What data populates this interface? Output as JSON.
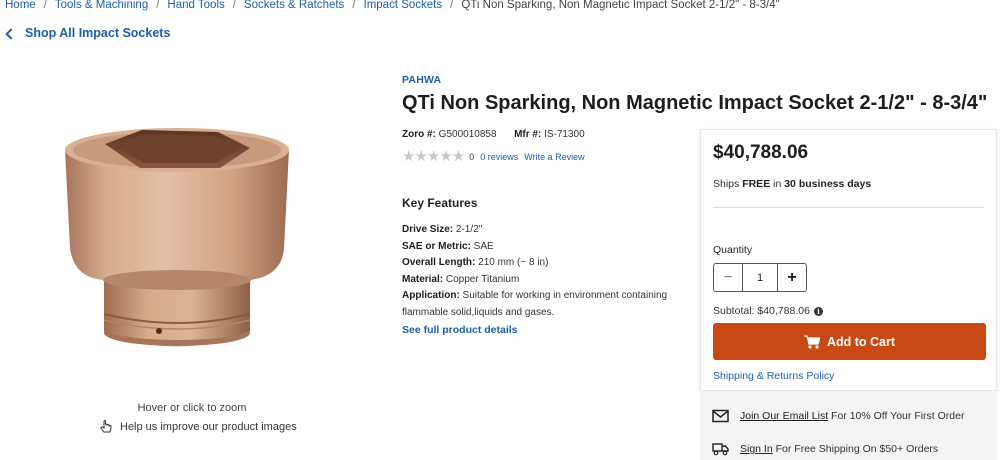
{
  "breadcrumb": {
    "items": [
      "Home",
      "Tools & Machining",
      "Hand Tools",
      "Sockets & Ratchets",
      "Impact Sockets"
    ],
    "current": "QTi Non Sparking, Non Magnetic Impact Socket 2-1/2\" - 8-3/4\"",
    "separator": "/"
  },
  "back_link": {
    "label": "Shop All Impact Sockets",
    "icon": "chevron-left-icon"
  },
  "image_area": {
    "zoom_hint": "Hover or click to zoom",
    "improve_label": "Help us improve our product images",
    "improve_icon": "hand-pointer-icon"
  },
  "product": {
    "brand": "PAHWA",
    "title": "QTi Non Sparking, Non Magnetic Impact Socket 2-1/2\" - 8-3/4\"",
    "zoro_label": "Zoro #:",
    "zoro_value": "G500010858",
    "mfr_label": "Mfr #:",
    "mfr_value": "IS-71300",
    "rating_stars": 0,
    "rating_count": "0",
    "reviews_link": "0 reviews",
    "write_review": "Write a Review"
  },
  "features": {
    "heading": "Key Features",
    "rows": [
      {
        "label": "Drive Size:",
        "value": " 2-1/2\""
      },
      {
        "label": "SAE or Metric:",
        "value": " SAE"
      },
      {
        "label": "Overall Length:",
        "value": " 210 mm (~ 8 in)"
      },
      {
        "label": "Material:",
        "value": " Copper Titanium"
      },
      {
        "label": "Application:",
        "value": " Suitable for working in environment containing flammable solid,liquids and gases."
      }
    ],
    "see_details": "See full product details"
  },
  "buy_box": {
    "price": "$40,788.06",
    "ships_prefix": "Ships ",
    "ships_free": "FREE",
    "ships_mid": " in ",
    "ships_days": "30 business days",
    "quantity_label": "Quantity",
    "quantity_value": "1",
    "minus_label": "−",
    "plus_label": "+",
    "subtotal": "Subtotal: $40,788.06",
    "add_to_cart": "Add to Cart",
    "policy_link": "Shipping & Returns Policy"
  },
  "promos": [
    {
      "icon": "envelope-icon",
      "link": "Join Our Email List",
      "text": " For 10% Off Your First Order"
    },
    {
      "icon": "truck-icon",
      "link": "Sign In",
      "text": " For Free Shipping On $50+ Orders"
    }
  ],
  "colors": {
    "link": "#1d5ea8",
    "cta": "#c84913",
    "star_empty": "#c8c8c8",
    "socket_copper": "#c99a7a"
  }
}
